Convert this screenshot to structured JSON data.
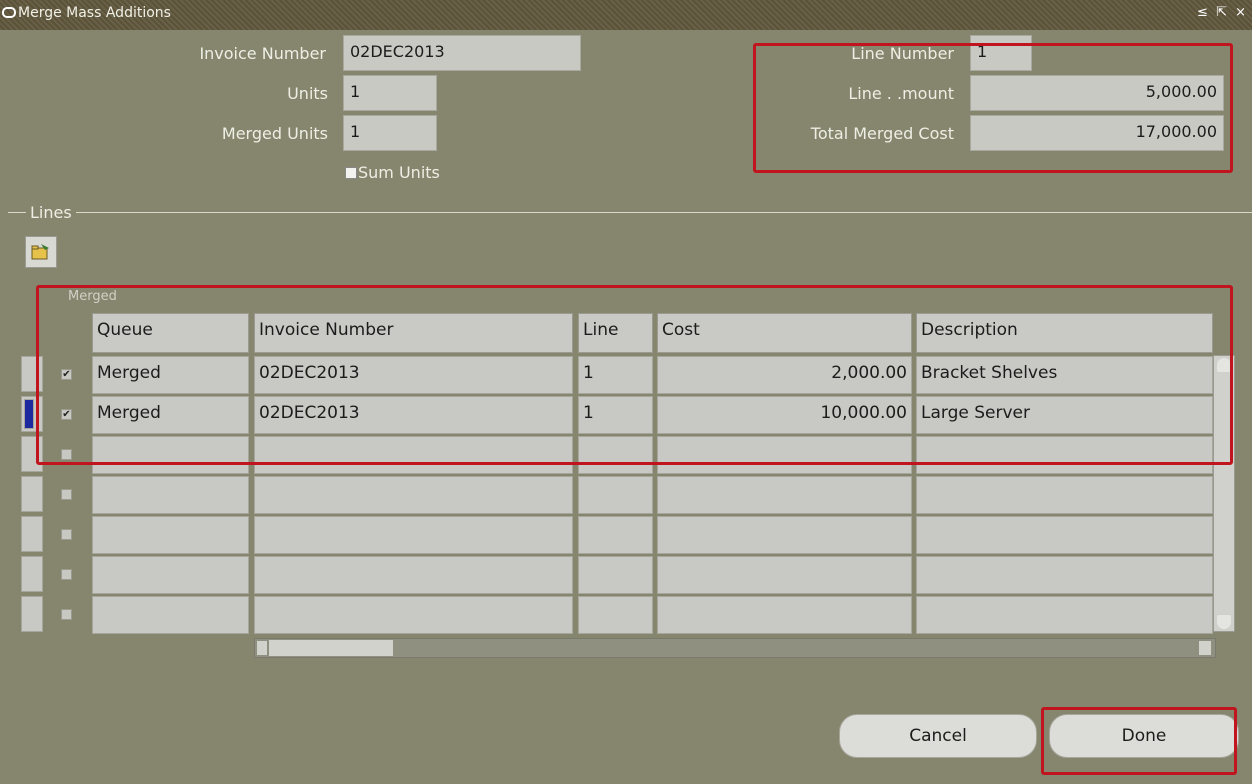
{
  "window": {
    "title": "Merge Mass Additions",
    "controls": "≤ ⇱ ×"
  },
  "header": {
    "invoice_number_label": "Invoice Number",
    "invoice_number_value": "02DEC2013",
    "units_label": "Units",
    "units_value": "1",
    "merged_units_label": "Merged Units",
    "merged_units_value": "1",
    "sum_units_label": "Sum Units",
    "line_number_label": "Line Number",
    "line_number_value": "1",
    "line_amount_label": "Line . .mount",
    "line_amount_value": "5,000.00",
    "total_merged_cost_label": "Total Merged Cost",
    "total_merged_cost_value": "17,000.00"
  },
  "lines": {
    "group_label": "Lines",
    "merged_header": "Merged",
    "columns": [
      "Queue",
      "Invoice Number",
      "Line",
      "Cost",
      "Description"
    ],
    "rows": [
      {
        "merged": true,
        "queue": "Merged",
        "invoice": "02DEC2013",
        "line": "1",
        "cost": "2,000.00",
        "description": "Bracket Shelves"
      },
      {
        "merged": true,
        "queue": "Merged",
        "invoice": "02DEC2013",
        "line": "1",
        "cost": "10,000.00",
        "description": "Large Server"
      },
      {
        "merged": false,
        "queue": "",
        "invoice": "",
        "line": "",
        "cost": "",
        "description": ""
      },
      {
        "merged": false,
        "queue": "",
        "invoice": "",
        "line": "",
        "cost": "",
        "description": ""
      },
      {
        "merged": false,
        "queue": "",
        "invoice": "",
        "line": "",
        "cost": "",
        "description": ""
      },
      {
        "merged": false,
        "queue": "",
        "invoice": "",
        "line": "",
        "cost": "",
        "description": ""
      },
      {
        "merged": false,
        "queue": "",
        "invoice": "",
        "line": "",
        "cost": "",
        "description": ""
      }
    ]
  },
  "buttons": {
    "cancel": "Cancel",
    "done": "Done"
  },
  "colors": {
    "background": "#86866f",
    "title_bar": "#5b5238",
    "highlight": "#c0141e",
    "field": "#c9c9c4"
  }
}
